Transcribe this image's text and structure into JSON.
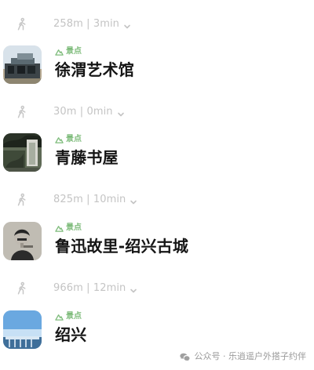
{
  "route": {
    "segments": [
      {
        "icon": "walk-icon",
        "label": "258m | 3min"
      },
      {
        "icon": "walk-icon",
        "label": "30m | 0min"
      },
      {
        "icon": "walk-icon",
        "label": "825m | 10min"
      },
      {
        "icon": "walk-icon",
        "label": "966m | 12min"
      }
    ],
    "pois": [
      {
        "tag": "景点",
        "title": "徐渭艺术馆",
        "thumb": "building-photo"
      },
      {
        "tag": "景点",
        "title": "青藤书屋",
        "thumb": "garden-photo"
      },
      {
        "tag": "景点",
        "title": "鲁迅故里-绍兴古城",
        "thumb": "portrait-photo"
      },
      {
        "tag": "景点",
        "title": "绍兴",
        "thumb": "sky-photo"
      }
    ]
  },
  "watermark": {
    "text": "公众号 · 乐逍遥户外搭子约伴",
    "icon": "wechat-icon"
  },
  "colors": {
    "tag_green": "#7dbb7a",
    "muted_gray": "#c4c4c4",
    "title": "#151515"
  }
}
